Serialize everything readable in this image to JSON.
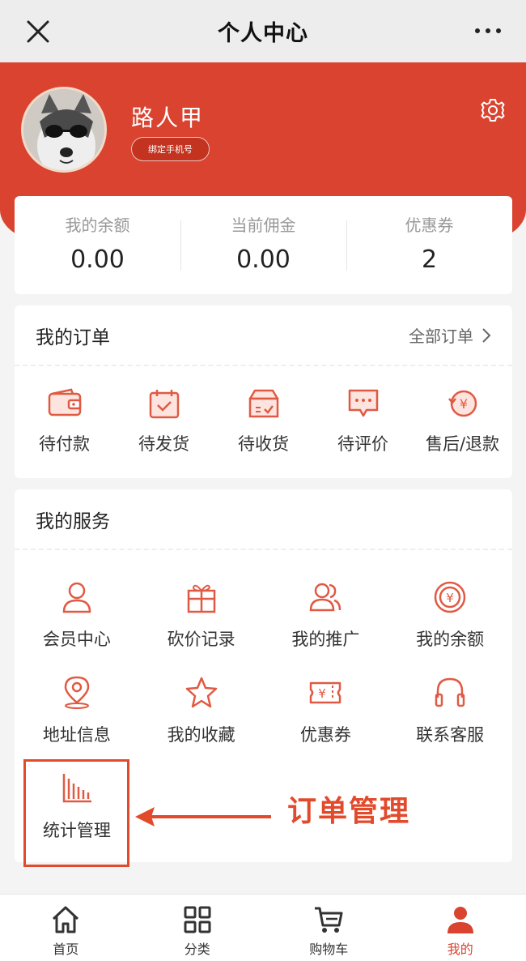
{
  "titlebar": {
    "title": "个人中心"
  },
  "profile": {
    "name": "路人甲",
    "bind_label": "绑定手机号"
  },
  "stats": [
    {
      "label": "我的余额",
      "value": "0.00"
    },
    {
      "label": "当前佣金",
      "value": "0.00"
    },
    {
      "label": "优惠券",
      "value": "2"
    }
  ],
  "orders": {
    "title": "我的订单",
    "more_label": "全部订单",
    "items": [
      {
        "label": "待付款",
        "icon": "wallet-icon"
      },
      {
        "label": "待发货",
        "icon": "calendar-check-icon"
      },
      {
        "label": "待收货",
        "icon": "box-icon"
      },
      {
        "label": "待评价",
        "icon": "chat-icon"
      },
      {
        "label": "售后/退款",
        "icon": "refund-icon"
      }
    ]
  },
  "services": {
    "title": "我的服务",
    "items": [
      {
        "label": "会员中心",
        "icon": "user-icon"
      },
      {
        "label": "砍价记录",
        "icon": "gift-icon"
      },
      {
        "label": "我的推广",
        "icon": "users-icon"
      },
      {
        "label": "我的余额",
        "icon": "coin-icon"
      },
      {
        "label": "地址信息",
        "icon": "location-icon"
      },
      {
        "label": "我的收藏",
        "icon": "star-icon"
      },
      {
        "label": "优惠券",
        "icon": "ticket-icon"
      },
      {
        "label": "联系客服",
        "icon": "headset-icon"
      },
      {
        "label": "统计管理",
        "icon": "bar-chart-icon"
      }
    ]
  },
  "annotation": {
    "text": "订单管理"
  },
  "tabbar": {
    "items": [
      {
        "label": "首页",
        "icon": "home-icon"
      },
      {
        "label": "分类",
        "icon": "grid-icon"
      },
      {
        "label": "购物车",
        "icon": "cart-icon"
      },
      {
        "label": "我的",
        "icon": "person-icon"
      }
    ]
  },
  "colors": {
    "accent": "#d9432f",
    "annotation": "#e24a2c",
    "background": "#f4f4f4"
  }
}
